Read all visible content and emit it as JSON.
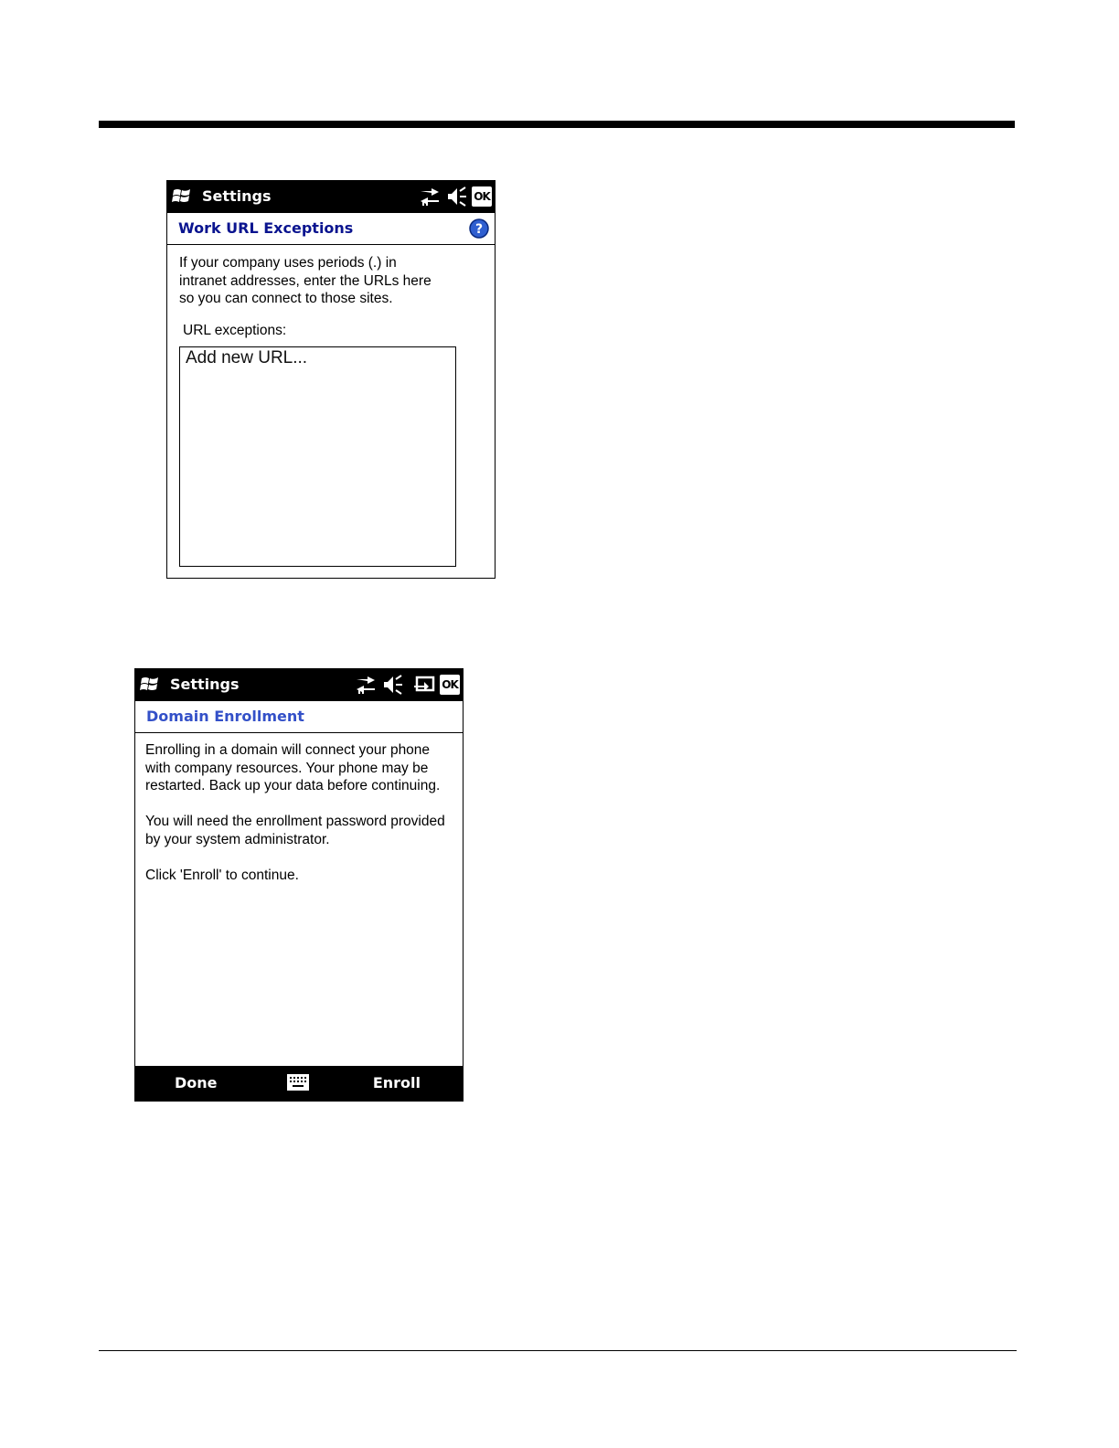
{
  "screens": [
    {
      "titlebar": {
        "title": "Settings",
        "icons": [
          "windows-start-icon",
          "connectivity-icon",
          "speaker-muted-icon"
        ],
        "ok_label": "OK"
      },
      "header": {
        "title": "Work URL Exceptions",
        "help_icon": "help-icon"
      },
      "description_lines": [
        "If your company uses periods (.) in",
        "intranet addresses, enter the URLs here",
        "so you can connect to those sites."
      ],
      "url_exceptions_label": "URL exceptions:",
      "url_list": [
        "Add new URL..."
      ]
    },
    {
      "titlebar": {
        "title": "Settings",
        "icons": [
          "windows-start-icon",
          "connectivity-icon",
          "speaker-muted-icon",
          "connection-status-icon"
        ],
        "ok_label": "OK"
      },
      "header": {
        "title": "Domain Enrollment"
      },
      "paragraphs": [
        [
          "Enrolling in a domain will connect your phone",
          "with company resources. Your phone may be",
          "restarted. Back up your data before continuing."
        ],
        [
          "You will need the enrollment password provided",
          "by your system administrator."
        ],
        [
          "Click 'Enroll' to continue."
        ]
      ],
      "softkeys": {
        "left": "Done",
        "center_icon": "keyboard-icon",
        "right": "Enroll"
      }
    }
  ]
}
